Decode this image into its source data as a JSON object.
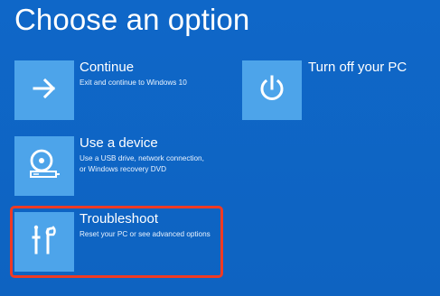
{
  "page": {
    "title": "Choose an option"
  },
  "options": {
    "continue": {
      "label": "Continue",
      "description": "Exit and continue to Windows 10",
      "icon": "arrow-right-icon"
    },
    "use_device": {
      "label": "Use a device",
      "description": "Use a USB drive, network connection,\nor Windows recovery DVD",
      "icon": "disc-drive-icon"
    },
    "troubleshoot": {
      "label": "Troubleshoot",
      "description": "Reset your PC or see advanced options",
      "icon": "tools-icon",
      "highlighted": true
    },
    "turn_off": {
      "label": "Turn off your PC",
      "icon": "power-icon"
    }
  },
  "colors": {
    "background": "#0f66c5",
    "tile": "#4da4ea",
    "text": "#ffffff",
    "highlight": "#ef3a23"
  }
}
